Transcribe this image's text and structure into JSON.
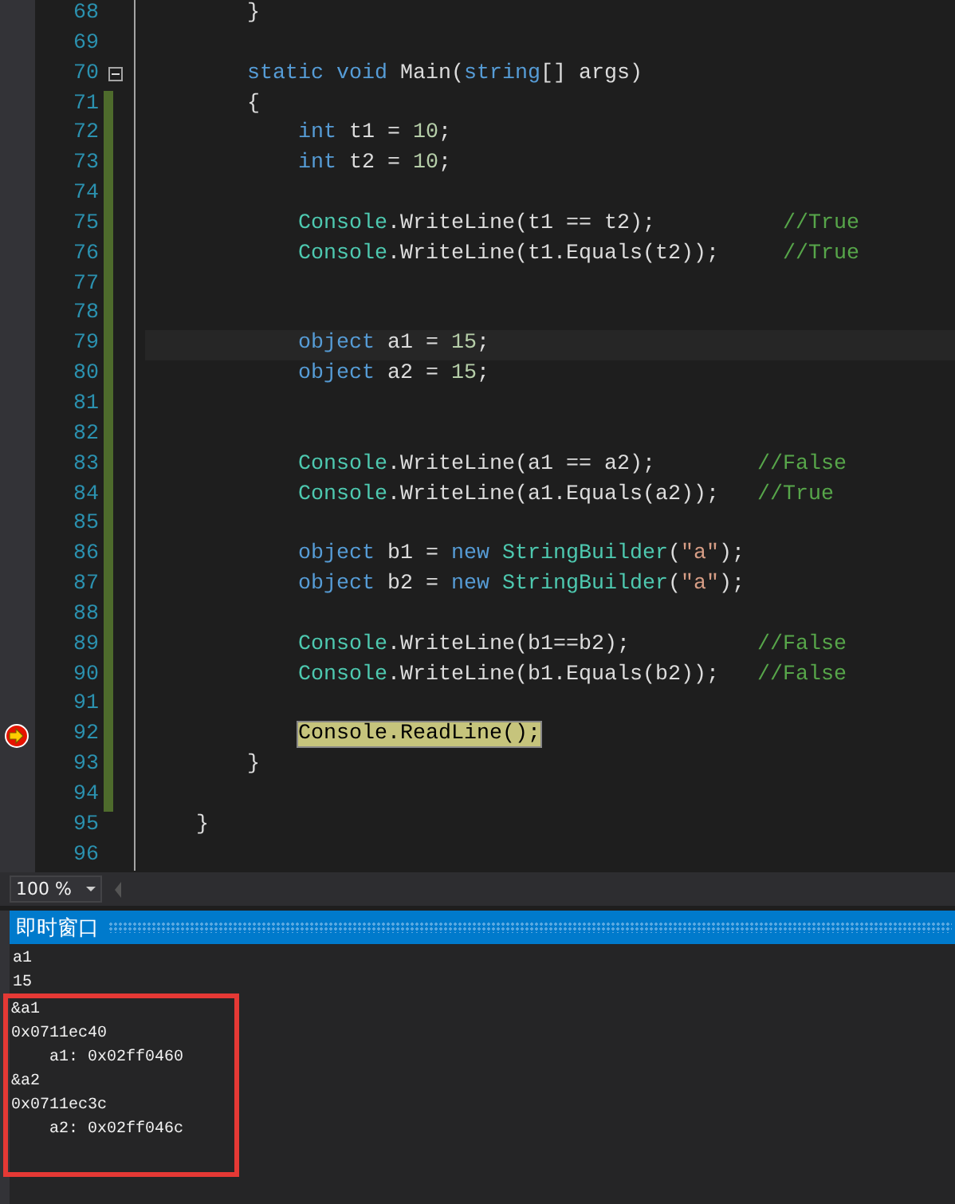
{
  "code_editor": {
    "lines": [
      {
        "number": "68",
        "changed": false,
        "current": false,
        "execution_point": false,
        "tokens": [
          {
            "kind": "plain",
            "text": "        }"
          }
        ]
      },
      {
        "number": "69",
        "changed": false,
        "current": false,
        "execution_point": false
      },
      {
        "number": "70",
        "changed": false,
        "current": false,
        "execution_point": false,
        "expanded": true,
        "tokens": [
          {
            "kind": "keyword",
            "text": "        static void "
          },
          {
            "kind": "plain",
            "text": "Main("
          },
          {
            "kind": "keyword",
            "text": "string"
          },
          {
            "kind": "plain",
            "text": "[] args)"
          }
        ]
      },
      {
        "number": "71",
        "changed": true,
        "current": false,
        "execution_point": false,
        "tokens": [
          {
            "kind": "plain",
            "text": "        {"
          }
        ]
      },
      {
        "number": "72",
        "changed": true,
        "current": false,
        "execution_point": false,
        "tokens": [
          {
            "kind": "keyword",
            "text": "            int"
          },
          {
            "kind": "plain",
            "text": " t1 = "
          },
          {
            "kind": "number",
            "text": "10"
          },
          {
            "kind": "plain",
            "text": ";"
          }
        ]
      },
      {
        "number": "73",
        "changed": true,
        "current": false,
        "execution_point": false,
        "tokens": [
          {
            "kind": "keyword",
            "text": "            int"
          },
          {
            "kind": "plain",
            "text": " t2 = "
          },
          {
            "kind": "number",
            "text": "10"
          },
          {
            "kind": "plain",
            "text": ";"
          }
        ]
      },
      {
        "number": "74",
        "changed": true,
        "current": false,
        "execution_point": false
      },
      {
        "number": "75",
        "changed": true,
        "current": false,
        "execution_point": false,
        "tokens": [
          {
            "kind": "type",
            "text": "            Console"
          },
          {
            "kind": "plain",
            "text": ".WriteLine(t1 == t2);          "
          },
          {
            "kind": "comment",
            "text": "//True"
          }
        ]
      },
      {
        "number": "76",
        "changed": true,
        "current": false,
        "execution_point": false,
        "tokens": [
          {
            "kind": "type",
            "text": "            Console"
          },
          {
            "kind": "plain",
            "text": ".WriteLine(t1.Equals(t2));     "
          },
          {
            "kind": "comment",
            "text": "//True"
          }
        ]
      },
      {
        "number": "77",
        "changed": true,
        "current": false,
        "execution_point": false
      },
      {
        "number": "78",
        "changed": true,
        "current": false,
        "execution_point": false
      },
      {
        "number": "79",
        "changed": true,
        "current": true,
        "execution_point": false,
        "tokens": [
          {
            "kind": "keyword",
            "text": "            object"
          },
          {
            "kind": "plain",
            "text": " a1 = "
          },
          {
            "kind": "number",
            "text": "15"
          },
          {
            "kind": "plain",
            "text": ";"
          }
        ]
      },
      {
        "number": "80",
        "changed": true,
        "current": false,
        "execution_point": false,
        "tokens": [
          {
            "kind": "keyword",
            "text": "            object"
          },
          {
            "kind": "plain",
            "text": " a2 = "
          },
          {
            "kind": "number",
            "text": "15"
          },
          {
            "kind": "plain",
            "text": ";"
          }
        ]
      },
      {
        "number": "81",
        "changed": true,
        "current": false,
        "execution_point": false
      },
      {
        "number": "82",
        "changed": true,
        "current": false,
        "execution_point": false
      },
      {
        "number": "83",
        "changed": true,
        "current": false,
        "execution_point": false,
        "tokens": [
          {
            "kind": "type",
            "text": "            Console"
          },
          {
            "kind": "plain",
            "text": ".WriteLine(a1 == a2);        "
          },
          {
            "kind": "comment",
            "text": "//False"
          }
        ]
      },
      {
        "number": "84",
        "changed": true,
        "current": false,
        "execution_point": false,
        "tokens": [
          {
            "kind": "type",
            "text": "            Console"
          },
          {
            "kind": "plain",
            "text": ".WriteLine(a1.Equals(a2));   "
          },
          {
            "kind": "comment",
            "text": "//True"
          }
        ]
      },
      {
        "number": "85",
        "changed": true,
        "current": false,
        "execution_point": false
      },
      {
        "number": "86",
        "changed": true,
        "current": false,
        "execution_point": false,
        "tokens": [
          {
            "kind": "keyword",
            "text": "            object"
          },
          {
            "kind": "plain",
            "text": " b1 = "
          },
          {
            "kind": "keyword",
            "text": "new "
          },
          {
            "kind": "type",
            "text": "StringBuilder"
          },
          {
            "kind": "plain",
            "text": "("
          },
          {
            "kind": "string",
            "text": "\"a\""
          },
          {
            "kind": "plain",
            "text": ");"
          }
        ]
      },
      {
        "number": "87",
        "changed": true,
        "current": false,
        "execution_point": false,
        "tokens": [
          {
            "kind": "keyword",
            "text": "            object"
          },
          {
            "kind": "plain",
            "text": " b2 = "
          },
          {
            "kind": "keyword",
            "text": "new "
          },
          {
            "kind": "type",
            "text": "StringBuilder"
          },
          {
            "kind": "plain",
            "text": "("
          },
          {
            "kind": "string",
            "text": "\"a\""
          },
          {
            "kind": "plain",
            "text": ");"
          }
        ]
      },
      {
        "number": "88",
        "changed": true,
        "current": false,
        "execution_point": false
      },
      {
        "number": "89",
        "changed": true,
        "current": false,
        "execution_point": false,
        "tokens": [
          {
            "kind": "type",
            "text": "            Console"
          },
          {
            "kind": "plain",
            "text": ".WriteLine(b1==b2);          "
          },
          {
            "kind": "comment",
            "text": "//False"
          }
        ]
      },
      {
        "number": "90",
        "changed": true,
        "current": false,
        "execution_point": false,
        "tokens": [
          {
            "kind": "type",
            "text": "            Console"
          },
          {
            "kind": "plain",
            "text": ".WriteLine(b1.Equals(b2));   "
          },
          {
            "kind": "comment",
            "text": "//False"
          }
        ]
      },
      {
        "number": "91",
        "changed": true,
        "current": false,
        "execution_point": false
      },
      {
        "number": "92",
        "changed": true,
        "current": false,
        "execution_point": true,
        "tokens": [
          {
            "kind": "plain",
            "text": "            Console.ReadLine();"
          }
        ]
      },
      {
        "number": "93",
        "changed": true,
        "current": false,
        "execution_point": false,
        "tokens": [
          {
            "kind": "plain",
            "text": "        }"
          }
        ]
      },
      {
        "number": "94",
        "changed": true,
        "current": false,
        "execution_point": false
      },
      {
        "number": "95",
        "changed": false,
        "current": false,
        "execution_point": false,
        "tokens": [
          {
            "kind": "plain",
            "text": "    }"
          }
        ]
      },
      {
        "number": "96",
        "changed": false,
        "current": false,
        "execution_point": false
      }
    ]
  },
  "zoom": {
    "value": "100 %"
  },
  "immediate_window": {
    "title": "即时窗口",
    "lines": [
      {
        "text": "a1",
        "framed": false
      },
      {
        "text": "15",
        "framed": false
      },
      {
        "text": "&a1",
        "framed": true
      },
      {
        "text": "0x0711ec40",
        "framed": true
      },
      {
        "text": "    a1: 0x02ff0460",
        "framed": true
      },
      {
        "text": "&a2",
        "framed": true
      },
      {
        "text": "0x0711ec3c",
        "framed": true
      },
      {
        "text": "    a2: 0x02ff046c",
        "framed": true
      }
    ]
  }
}
